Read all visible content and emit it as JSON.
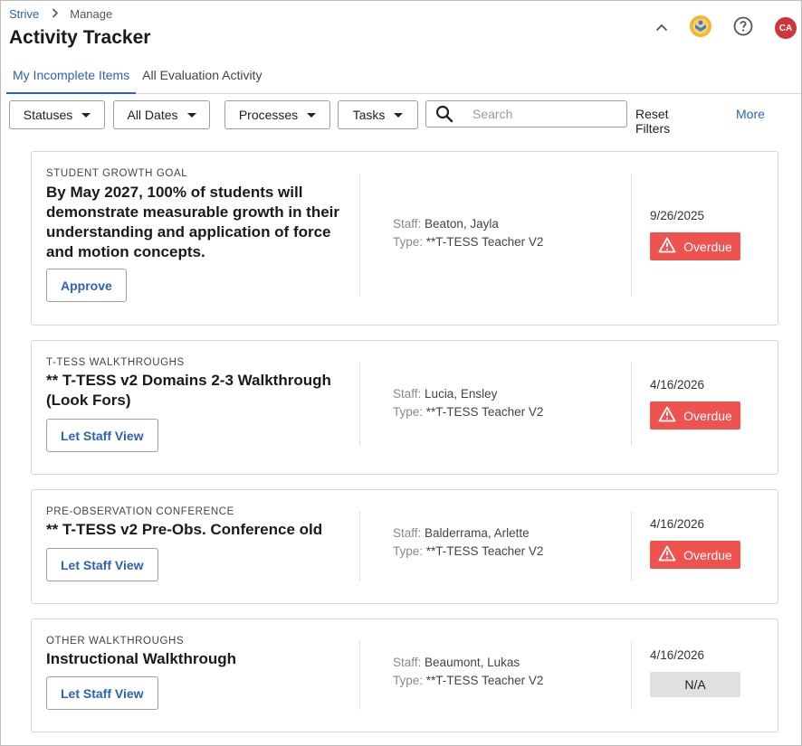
{
  "breadcrumb": {
    "root": "Strive",
    "current": "Manage"
  },
  "page": {
    "title": "Activity Tracker"
  },
  "header": {
    "avatar_initials": "CA"
  },
  "tabs": [
    {
      "label": "My Incomplete Items",
      "active": true
    },
    {
      "label": "All Evaluation Activity",
      "active": false
    }
  ],
  "filters": {
    "statuses": "Statuses",
    "dates": "All Dates",
    "processes": "Processes",
    "tasks": "Tasks",
    "search_placeholder": "Search",
    "reset": "Reset Filters",
    "more": "More"
  },
  "labels": {
    "staff": "Staff:",
    "type": "Type:"
  },
  "colors": {
    "accent": "#2e62b6",
    "overdue": "#ef5350",
    "avatar": "#d0353a"
  },
  "items": [
    {
      "category": "STUDENT GROWTH GOAL",
      "title": "By May 2027, 100% of students will demonstrate measurable growth in their understanding and application of force and motion concepts.",
      "action": "Approve",
      "staff": "Beaton, Jayla",
      "type": "**T-TESS Teacher V2",
      "date": "9/26/2025",
      "status": "Overdue"
    },
    {
      "category": "T-TESS WALKTHROUGHS",
      "title": "** T-TESS v2 Domains 2-3 Walkthrough (Look Fors)",
      "action": "Let Staff View",
      "staff": "Lucia, Ensley",
      "type": "**T-TESS Teacher V2",
      "date": "4/16/2026",
      "status": "Overdue"
    },
    {
      "category": "PRE-OBSERVATION CONFERENCE",
      "title": "** T-TESS v2 Pre-Obs. Conference old",
      "action": "Let Staff View",
      "staff": "Balderrama, Arlette",
      "type": "**T-TESS Teacher V2",
      "date": "4/16/2026",
      "status": "Overdue"
    },
    {
      "category": "OTHER WALKTHROUGHS",
      "title": "Instructional Walkthrough",
      "action": "Let Staff View",
      "staff": "Beaumont, Lukas",
      "type": "**T-TESS Teacher V2",
      "date": "4/16/2026",
      "status": "N/A"
    }
  ]
}
